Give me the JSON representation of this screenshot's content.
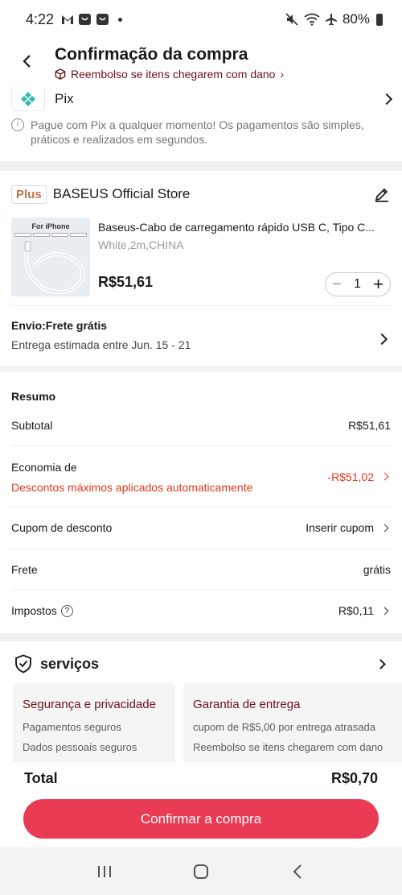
{
  "status": {
    "time": "4:22",
    "battery": "80%"
  },
  "header": {
    "title": "Confirmação da compra",
    "refund_notice": "Reembolso se itens chegarem com dano"
  },
  "payment": {
    "method": "Pix",
    "info": "Pague com Pix a qualquer momento! Os pagamentos são simples, práticos e realizados em segundos."
  },
  "store": {
    "badge": "Plus",
    "name": "BASEUS Official Store",
    "product": {
      "thumb_label": "For iPhone",
      "title": "Baseus-Cabo de carregamento rápido USB C, Tipo C...",
      "variant": "White,2m,CHINA",
      "price": "R$51,61",
      "quantity": "1"
    },
    "shipping": {
      "title": "Envio:Frete grátis",
      "estimate": "Entrega estimada entre Jun. 15 - 21"
    }
  },
  "summary": {
    "title": "Resumo",
    "subtotal_label": "Subtotal",
    "subtotal_value": "R$51,61",
    "savings_label": "Economia de",
    "savings_sub": "Descontos máximos aplicados automaticamente",
    "savings_value": "-R$51,02",
    "coupon_label": "Cupom de desconto",
    "coupon_value": "Inserir cupom",
    "shipping_label": "Frete",
    "shipping_value": "grátis",
    "taxes_label": "Impostos",
    "taxes_value": "R$0,11"
  },
  "services": {
    "title": "serviços",
    "boxes": [
      {
        "title": "Segurança e privacidade",
        "lines": [
          "Pagamentos seguros",
          "Dados pessoais seguros"
        ]
      },
      {
        "title": "Garantia de entrega",
        "lines": [
          "cupom de R$5,00 por entrega atrasada",
          "Reembolso se itens chegarem com dano"
        ]
      }
    ]
  },
  "footer": {
    "total_label": "Total",
    "total_value": "R$0,70",
    "confirm_label": "Confirmar a compra"
  },
  "colors": {
    "accent": "#ea3b54",
    "discount_red": "#e2391b",
    "maroon": "#6b0f1a",
    "pix_teal": "#32bcad"
  },
  "icons": [
    "gmail-icon",
    "app-icon",
    "mute-icon",
    "wifi-icon",
    "airplane-icon",
    "battery-icon",
    "back-arrow-icon",
    "package-icon",
    "pix-logo-icon",
    "info-icon",
    "edit-icon",
    "shield-check-icon",
    "recents-icon",
    "home-icon",
    "nav-back-icon"
  ]
}
